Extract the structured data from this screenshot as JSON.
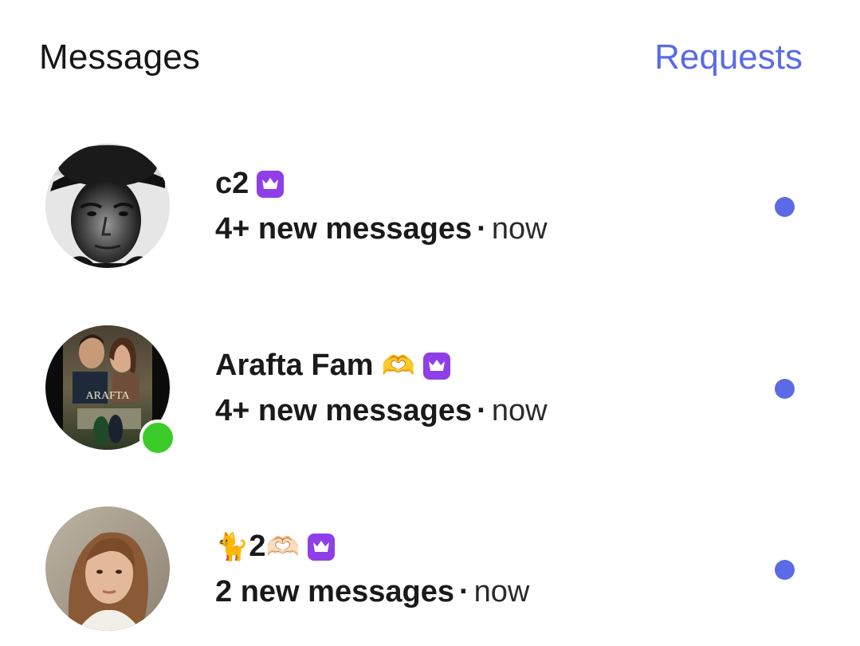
{
  "header": {
    "title": "Messages",
    "requests_label": "Requests"
  },
  "colors": {
    "accent": "#5b6ae6",
    "badge": "#8f3ee8",
    "online": "#3ccc2a"
  },
  "conversations": [
    {
      "name": "c2",
      "name_emoji": "",
      "name_suffix": "",
      "badge_icon": "crown-badge-icon",
      "count_text": "4+ new messages",
      "separator": "·",
      "time": "now",
      "online": false,
      "unread": true
    },
    {
      "name": "Arafta Fam",
      "name_emoji": "",
      "name_suffix": "🫶",
      "badge_icon": "crown-badge-icon",
      "count_text": "4+ new messages",
      "separator": "·",
      "time": "now",
      "online": true,
      "unread": true,
      "avatar_caption": "ARAFTA"
    },
    {
      "name": "2",
      "name_emoji": "🐈",
      "name_suffix": "🫶🏻",
      "badge_icon": "crown-badge-icon",
      "count_text": "2 new messages",
      "separator": "·",
      "time": "now",
      "online": false,
      "unread": true
    }
  ]
}
